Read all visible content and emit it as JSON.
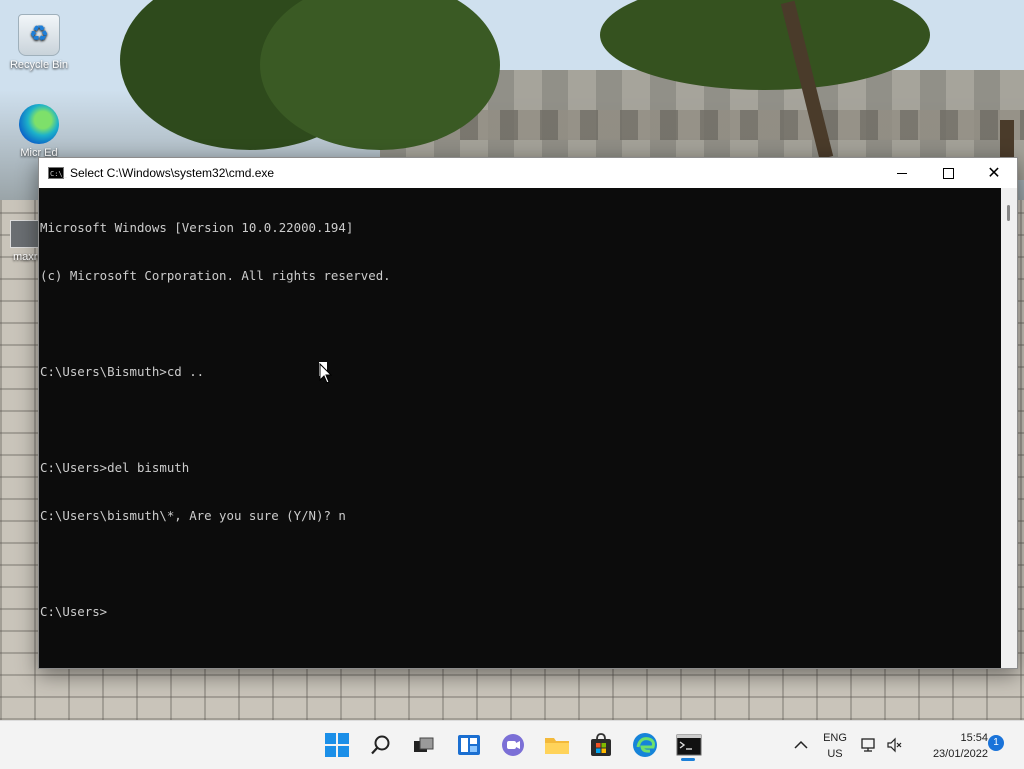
{
  "desktop": {
    "icons": [
      {
        "label": "Recycle Bin",
        "icon": "recycle-bin-icon"
      },
      {
        "label": "Micr Ed",
        "icon": "edge-icon"
      },
      {
        "label": "maxres",
        "icon": "image-file-icon"
      }
    ]
  },
  "window": {
    "title": "Select C:\\Windows\\system32\\cmd.exe",
    "app_icon_text": "C:\\_",
    "lines": [
      "Microsoft Windows [Version 10.0.22000.194]",
      "(c) Microsoft Corporation. All rights reserved.",
      "",
      "C:\\Users\\Bismuth>cd ..",
      "",
      "C:\\Users>del bismuth",
      "C:\\Users\\bismuth\\*, Are you sure (Y/N)? n",
      "",
      "C:\\Users>"
    ],
    "colors": {
      "background": "#0c0c0c",
      "text": "#cccccc"
    }
  },
  "taskbar": {
    "pinned": [
      {
        "name": "start",
        "icon": "windows-logo-icon"
      },
      {
        "name": "search",
        "icon": "search-icon"
      },
      {
        "name": "task-view",
        "icon": "task-view-icon"
      },
      {
        "name": "widgets",
        "icon": "widgets-icon"
      },
      {
        "name": "chat",
        "icon": "chat-icon"
      },
      {
        "name": "file-explorer",
        "icon": "folder-icon"
      },
      {
        "name": "store",
        "icon": "store-icon"
      },
      {
        "name": "edge",
        "icon": "edge-icon"
      },
      {
        "name": "command-prompt",
        "icon": "terminal-icon",
        "active": true
      }
    ],
    "tray": {
      "lang": "ENG",
      "region": "US",
      "time": "15:54",
      "date": "23/01/2022",
      "notification_count": "1"
    },
    "accent": "#1b8fe8"
  }
}
